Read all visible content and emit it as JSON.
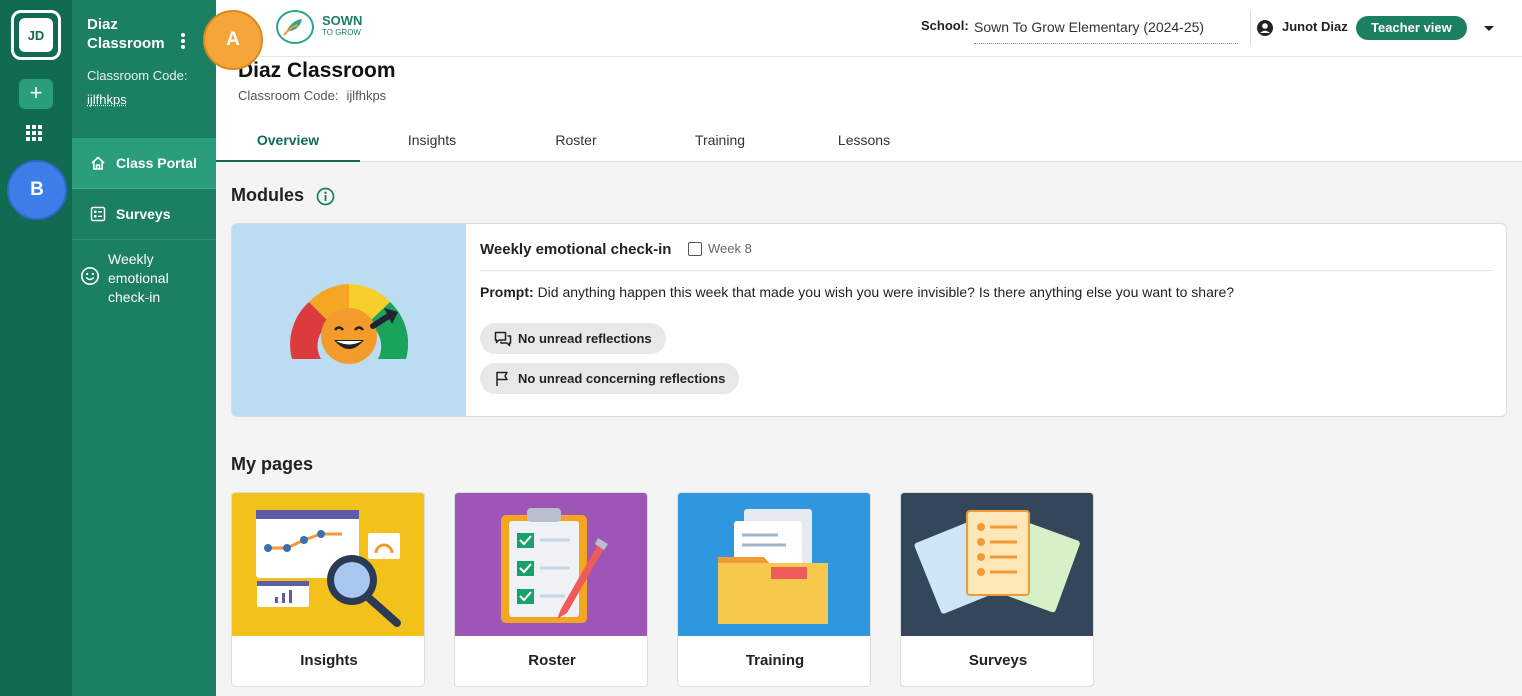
{
  "rail": {
    "avatar": "JD",
    "add": "+"
  },
  "markers": {
    "a": "A",
    "b": "B"
  },
  "sidebar": {
    "title": "Diaz Classroom",
    "code_label": "Classroom Code:",
    "code": "ijlfhkps",
    "items": [
      {
        "label": "Class Portal",
        "icon": "home-icon"
      },
      {
        "label": "Surveys",
        "icon": "survey-icon"
      }
    ],
    "sub_item": {
      "label": "Weekly emotional check-in",
      "icon": "smiley-icon"
    }
  },
  "header": {
    "logo_line1": "SOWN",
    "logo_line2": "TO GROW",
    "school_label": "School:",
    "school_value": "Sown To Grow Elementary (2024-25)",
    "user_name": "Junot Diaz",
    "view_label": "Teacher view"
  },
  "page": {
    "title": "Diaz Classroom",
    "code_label": "Classroom Code:",
    "code": "ijlfhkps",
    "tabs": [
      "Overview",
      "Insights",
      "Roster",
      "Training",
      "Lessons"
    ]
  },
  "modules": {
    "heading": "Modules",
    "card": {
      "title": "Weekly emotional check-in",
      "week": "Week 8",
      "prompt_label": "Prompt:",
      "prompt": "Did anything happen this week that made you wish you were invisible? Is there anything else you want to share?",
      "chips": [
        "No unread reflections",
        "No unread concerning reflections"
      ]
    }
  },
  "my_pages": {
    "heading": "My pages",
    "cards": [
      "Insights",
      "Roster",
      "Training",
      "Surveys"
    ]
  },
  "colors": {
    "rail": "#116a52",
    "sidebar": "#1b7f62",
    "accent": "#2a9d7c",
    "insights_bg": "#f2c21a",
    "roster_bg": "#9d55b8",
    "training_bg": "#2f97dd",
    "surveys_bg": "#34475a"
  }
}
